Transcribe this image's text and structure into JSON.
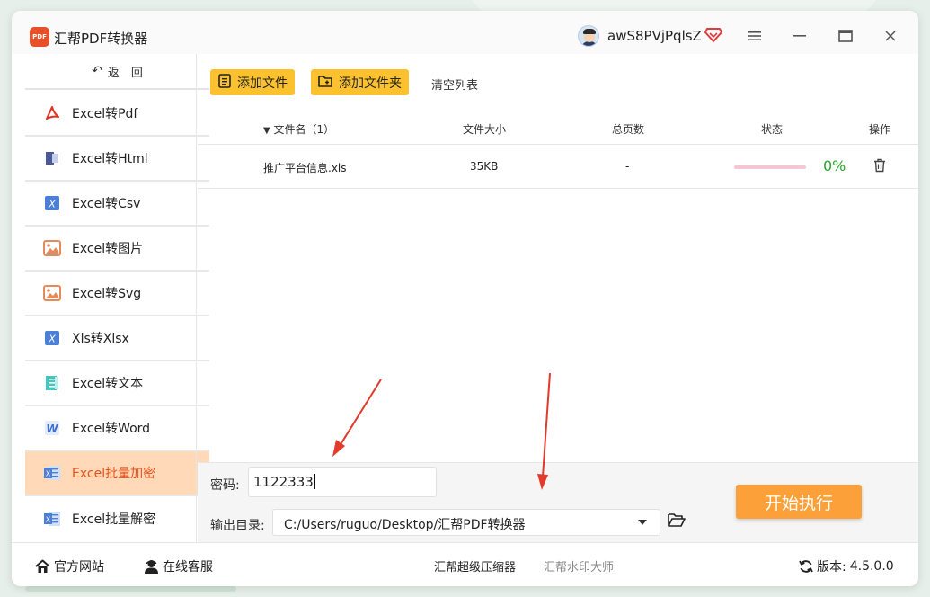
{
  "app": {
    "title": "汇帮PDF转换器",
    "logo_text": "PDF"
  },
  "user": {
    "name": "awS8PVjPqlsZ"
  },
  "sidebar": {
    "back_label": "返　回",
    "items": [
      {
        "label": "Excel转Pdf",
        "icon": "pdf-icon"
      },
      {
        "label": "Excel转Html",
        "icon": "html-icon"
      },
      {
        "label": "Excel转Csv",
        "icon": "excel-x-icon"
      },
      {
        "label": "Excel转图片",
        "icon": "image-icon"
      },
      {
        "label": "Excel转Svg",
        "icon": "image-icon"
      },
      {
        "label": "Xls转Xlsx",
        "icon": "excel-x-icon"
      },
      {
        "label": "Excel转文本",
        "icon": "text-icon"
      },
      {
        "label": "Excel转Word",
        "icon": "word-icon"
      },
      {
        "label": "Excel批量加密",
        "icon": "excel-icon",
        "active": true
      },
      {
        "label": "Excel批量解密",
        "icon": "excel-icon"
      }
    ]
  },
  "toolbar": {
    "add_file": "添加文件",
    "add_folder": "添加文件夹",
    "clear_list": "清空列表"
  },
  "table": {
    "headers": {
      "name": "文件名（1）",
      "size": "文件大小",
      "pages": "总页数",
      "status": "状态",
      "action": "操作"
    },
    "rows": [
      {
        "name": "推广平台信息.xls",
        "size": "35KB",
        "pages": "-",
        "progress": 0,
        "percent": "0%"
      }
    ]
  },
  "settings": {
    "password_label": "密码:",
    "password_value": "1122333",
    "output_label": "输出目录:",
    "output_value": "C:/Users/ruguo/Desktop/汇帮PDF转换器",
    "start_button": "开始执行"
  },
  "footer": {
    "website": "官方网站",
    "support": "在线客服",
    "compressor": "汇帮超级压缩器",
    "watermark": "汇帮水印大师",
    "version_label": "版本:",
    "version_value": "4.5.0.0"
  },
  "colors": {
    "accent_yellow": "#fcc12f",
    "start_orange": "#fca13a",
    "active_bg": "#ffd9b8",
    "active_text": "#e94e1b",
    "progress_green": "#2aa52a"
  }
}
